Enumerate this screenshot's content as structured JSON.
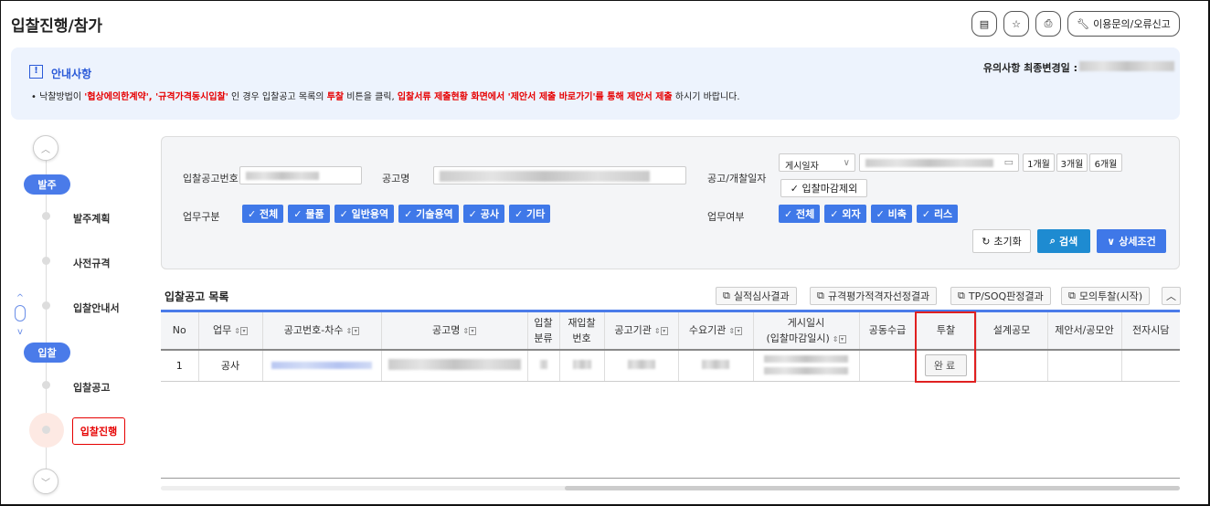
{
  "header": {
    "title": "입찰진행/참가",
    "manual_icon": "book-icon",
    "favorite_icon": "star-icon",
    "print_icon": "printer-icon",
    "inquiry_label": "이용문의/오류신고",
    "inquiry_icon": "wrench-icon"
  },
  "notice": {
    "title": "안내사항",
    "updated_label": "유의사항 최종변경일 :",
    "text_parts": [
      {
        "t": "낙찰방법이 ",
        "red": false
      },
      {
        "t": "'협상에의한계약', '규격가격동시입찰'",
        "red": true
      },
      {
        "t": " 인 경우 입찰공고 목록의 ",
        "red": false
      },
      {
        "t": "투찰",
        "red": true
      },
      {
        "t": " 비튼을 클릭, ",
        "red": false
      },
      {
        "t": "입찰서류 제출현황 화면에서 '제안서 제출 바로가기'를 통해 제안서 제출",
        "red": true
      },
      {
        "t": " 하시기 바랍니다.",
        "red": false
      }
    ]
  },
  "sidebar": {
    "groups": [
      {
        "label": "발주",
        "items": [
          "발주계획",
          "사전규격",
          "입찰안내서"
        ]
      },
      {
        "label": "입찰",
        "items": [
          "입찰공고",
          "입찰진행"
        ]
      }
    ],
    "active": "입찰진행"
  },
  "search": {
    "bid_no_label": "입찰공고번호",
    "name_label": "공고명",
    "date_label": "공고/개찰일자",
    "date_type": "게시일자",
    "period_buttons": [
      "1개월",
      "3개월",
      "6개월"
    ],
    "exclude_closed": "입찰마감제외",
    "biz_type_label": "업무구분",
    "biz_types": [
      "전체",
      "물품",
      "일반용역",
      "기술용역",
      "공사",
      "기타"
    ],
    "biz_status_label": "업무여부",
    "biz_status": [
      "전체",
      "외자",
      "비축",
      "리스"
    ],
    "reset": "초기화",
    "search": "검색",
    "detail": "상세조건"
  },
  "list": {
    "title": "입찰공고 목록",
    "actions": [
      "실적심사결과",
      "규격평가적격자선정결과",
      "TP/SOQ판정결과",
      "모의투찰(시작)"
    ],
    "columns": [
      {
        "h": "No"
      },
      {
        "h": "업무",
        "s": true
      },
      {
        "h": "공고번호-차수",
        "s": true
      },
      {
        "h": "공고명",
        "s": true
      },
      {
        "h": "입찰\n분류"
      },
      {
        "h": "재입찰\n번호"
      },
      {
        "h": "공고기관",
        "s": true
      },
      {
        "h": "수요기관",
        "s": true
      },
      {
        "h": "게시일시\n(입찰마감일시)",
        "s": true
      },
      {
        "h": "공동수급"
      },
      {
        "h": "투찰"
      },
      {
        "h": "설계공모"
      },
      {
        "h": "제안서/공모안"
      },
      {
        "h": "전자시담"
      }
    ],
    "rows": [
      {
        "no": "1",
        "biz": "공사",
        "bid": "완료"
      }
    ]
  },
  "colors": {
    "accent": "#4a7be9",
    "red": "#e60000",
    "highlight_border": "#e02020"
  }
}
